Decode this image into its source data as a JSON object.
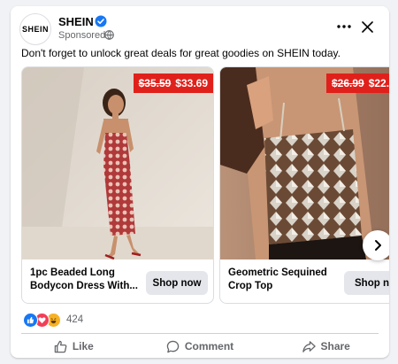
{
  "post": {
    "page_name": "SHEIN",
    "avatar_text": "SHEIN",
    "sponsored_label": "Sponsored ·",
    "caption": "Don't forget to unlock great deals for great goodies on SHEIN today."
  },
  "carousel": {
    "items": [
      {
        "old_price": "$35.59",
        "new_price": "$33.69",
        "title": "1pc Beaded Long Bodycon Dress With...",
        "cta": "Shop now"
      },
      {
        "old_price": "$26.99",
        "new_price": "$22.",
        "title": "Geometric Sequined Crop Top",
        "cta": "Shop no"
      }
    ]
  },
  "reactions": {
    "count": "424"
  },
  "actions": {
    "like": "Like",
    "comment": "Comment",
    "share": "Share"
  },
  "colors": {
    "price_tag": "#e0211b",
    "verified": "#1877f2",
    "like_reaction": "#1877f2",
    "love_reaction": "#f33e58",
    "haha_reaction": "#f7b125"
  },
  "icons": [
    "verified-badge-icon",
    "globe-icon",
    "more-options-icon",
    "close-icon",
    "chevron-right-icon",
    "like-reaction-icon",
    "love-reaction-icon",
    "haha-reaction-icon",
    "thumbs-up-icon",
    "comment-icon",
    "share-icon"
  ]
}
